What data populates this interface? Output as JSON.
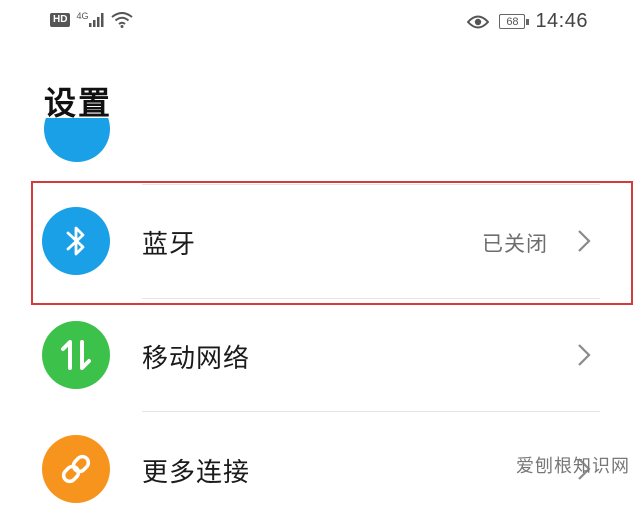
{
  "status_bar": {
    "hd_badge": "HD",
    "network": "4G",
    "icons": [
      "hd-icon",
      "signal-icon",
      "wifi-icon",
      "eye-icon",
      "battery-icon"
    ],
    "battery_level": "68",
    "time": "14:46"
  },
  "page": {
    "title": "设置"
  },
  "settings": [
    {
      "id": "bluetooth",
      "label": "蓝牙",
      "status": "已关闭",
      "icon": "bluetooth-icon",
      "icon_color": "#1aa0e6",
      "highlighted": true
    },
    {
      "id": "mobile-network",
      "label": "移动网络",
      "status": "",
      "icon": "mobile-data-icon",
      "icon_color": "#3cc24a",
      "highlighted": false
    },
    {
      "id": "more-connections",
      "label": "更多连接",
      "status": "",
      "icon": "link-icon",
      "icon_color": "#f7941d",
      "highlighted": false
    }
  ],
  "colors": {
    "highlight_border": "#d23c3c",
    "partial_icon": "#1aa0e6"
  },
  "watermark": "爱刨根知识网"
}
